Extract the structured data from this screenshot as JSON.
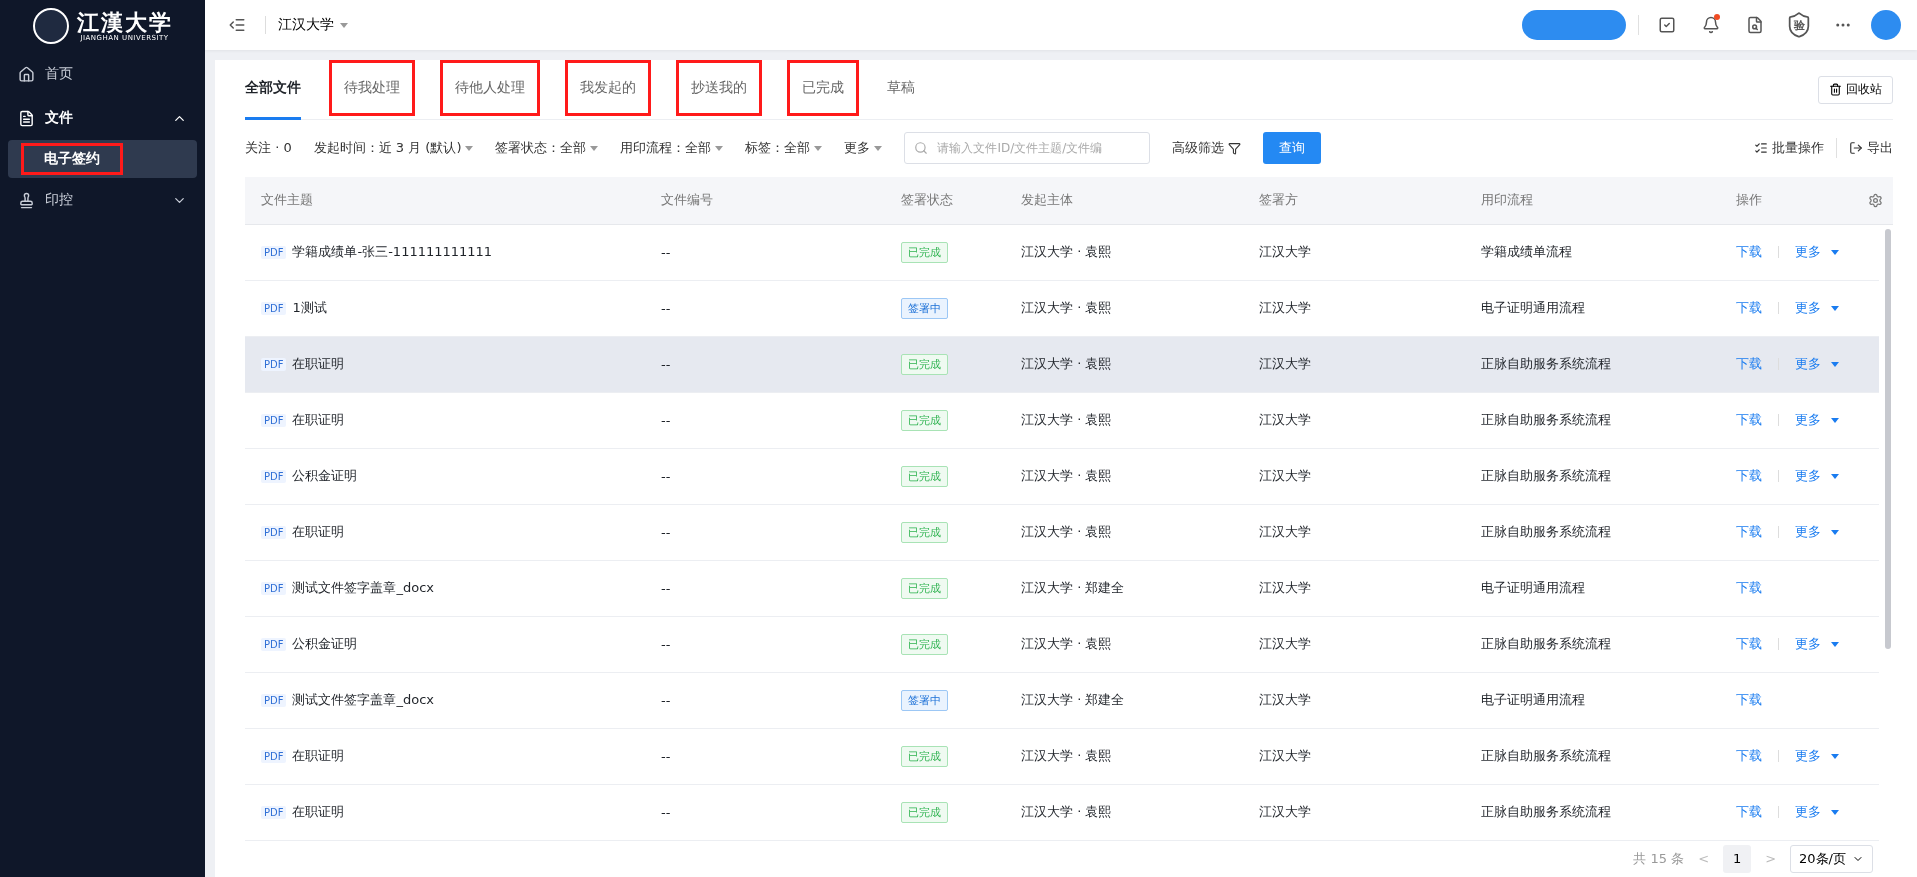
{
  "sidebar": {
    "logo_text": "江漢大学",
    "logo_subtext": "JIANGHAN UNIVERSITY",
    "items": [
      {
        "label": "首页",
        "kind": "home",
        "expanded": false
      },
      {
        "label": "文件",
        "kind": "file",
        "expanded": true,
        "children": [
          {
            "label": "电子签约",
            "selected": true,
            "annotated": true
          }
        ]
      },
      {
        "label": "印控",
        "kind": "stamp",
        "expanded": false
      }
    ]
  },
  "header": {
    "org": "江汉大学",
    "shield_text": "验",
    "notification_dot": true
  },
  "tabs": [
    {
      "label": "全部文件",
      "selected": true,
      "annotated": false
    },
    {
      "label": "待我处理",
      "selected": false,
      "annotated": true
    },
    {
      "label": "待他人处理",
      "selected": false,
      "annotated": true
    },
    {
      "label": "我发起的",
      "selected": false,
      "annotated": true
    },
    {
      "label": "抄送我的",
      "selected": false,
      "annotated": true
    },
    {
      "label": "已完成",
      "selected": false,
      "annotated": true
    },
    {
      "label": "草稿",
      "selected": false,
      "annotated": false
    }
  ],
  "recycle_button": "回收站",
  "filters": [
    {
      "label": "关注 · 0",
      "dropdown": false
    },
    {
      "label": "发起时间：近 3 月 (默认)",
      "dropdown": true
    },
    {
      "label": "签署状态：全部",
      "dropdown": true
    },
    {
      "label": "用印流程：全部",
      "dropdown": true
    },
    {
      "label": "标签：全部",
      "dropdown": true
    },
    {
      "label": "更多",
      "dropdown": true
    }
  ],
  "search": {
    "placeholder": "请输入文件ID/文件主题/文件编"
  },
  "advanced_filter": "高级筛选",
  "query_button": "查询",
  "batch_button": "批量操作",
  "export_button": "导出",
  "table": {
    "columns": [
      "文件主题",
      "文件编号",
      "签署状态",
      "发起主体",
      "签署方",
      "用印流程",
      "操作"
    ],
    "rows": [
      {
        "type": "PDF",
        "subject": "学籍成绩单-张三-111111111111",
        "number": "--",
        "status": {
          "label": "已完成",
          "kind": "done"
        },
        "initiator": "江汉大学 · 袁熙",
        "signer": "江汉大学",
        "flow": "学籍成绩单流程",
        "actions": [
          "下载",
          "更多"
        ],
        "highlighted": false
      },
      {
        "type": "PDF",
        "subject": "1测试",
        "number": "--",
        "status": {
          "label": "签署中",
          "kind": "signing"
        },
        "initiator": "江汉大学 · 袁熙",
        "signer": "江汉大学",
        "flow": "电子证明通用流程",
        "actions": [
          "下载",
          "更多"
        ],
        "highlighted": false
      },
      {
        "type": "PDF",
        "subject": "在职证明",
        "number": "--",
        "status": {
          "label": "已完成",
          "kind": "done"
        },
        "initiator": "江汉大学 · 袁熙",
        "signer": "江汉大学",
        "flow": "正脉自助服务系统流程",
        "actions": [
          "下载",
          "更多"
        ],
        "highlighted": true
      },
      {
        "type": "PDF",
        "subject": "在职证明",
        "number": "--",
        "status": {
          "label": "已完成",
          "kind": "done"
        },
        "initiator": "江汉大学 · 袁熙",
        "signer": "江汉大学",
        "flow": "正脉自助服务系统流程",
        "actions": [
          "下载",
          "更多"
        ],
        "highlighted": false
      },
      {
        "type": "PDF",
        "subject": "公积金证明",
        "number": "--",
        "status": {
          "label": "已完成",
          "kind": "done"
        },
        "initiator": "江汉大学 · 袁熙",
        "signer": "江汉大学",
        "flow": "正脉自助服务系统流程",
        "actions": [
          "下载",
          "更多"
        ],
        "highlighted": false
      },
      {
        "type": "PDF",
        "subject": "在职证明",
        "number": "--",
        "status": {
          "label": "已完成",
          "kind": "done"
        },
        "initiator": "江汉大学 · 袁熙",
        "signer": "江汉大学",
        "flow": "正脉自助服务系统流程",
        "actions": [
          "下载",
          "更多"
        ],
        "highlighted": false
      },
      {
        "type": "PDF",
        "subject": "测试文件签字盖章_docx",
        "number": "--",
        "status": {
          "label": "已完成",
          "kind": "done"
        },
        "initiator": "江汉大学 · 郑建全",
        "signer": "江汉大学",
        "flow": "电子证明通用流程",
        "actions": [
          "下载"
        ],
        "highlighted": false
      },
      {
        "type": "PDF",
        "subject": "公积金证明",
        "number": "--",
        "status": {
          "label": "已完成",
          "kind": "done"
        },
        "initiator": "江汉大学 · 袁熙",
        "signer": "江汉大学",
        "flow": "正脉自助服务系统流程",
        "actions": [
          "下载",
          "更多"
        ],
        "highlighted": false
      },
      {
        "type": "PDF",
        "subject": "测试文件签字盖章_docx",
        "number": "--",
        "status": {
          "label": "签署中",
          "kind": "signing"
        },
        "initiator": "江汉大学 · 郑建全",
        "signer": "江汉大学",
        "flow": "电子证明通用流程",
        "actions": [
          "下载"
        ],
        "highlighted": false
      },
      {
        "type": "PDF",
        "subject": "在职证明",
        "number": "--",
        "status": {
          "label": "已完成",
          "kind": "done"
        },
        "initiator": "江汉大学 · 袁熙",
        "signer": "江汉大学",
        "flow": "正脉自助服务系统流程",
        "actions": [
          "下载",
          "更多"
        ],
        "highlighted": false
      },
      {
        "type": "PDF",
        "subject": "在职证明",
        "number": "--",
        "status": {
          "label": "已完成",
          "kind": "done"
        },
        "initiator": "江汉大学 · 袁熙",
        "signer": "江汉大学",
        "flow": "正脉自助服务系统流程",
        "actions": [
          "下载",
          "更多"
        ],
        "highlighted": false
      }
    ]
  },
  "pagination": {
    "total": "共 15 条",
    "prev": "<",
    "page": "1",
    "next": ">",
    "page_size": "20条/页"
  }
}
